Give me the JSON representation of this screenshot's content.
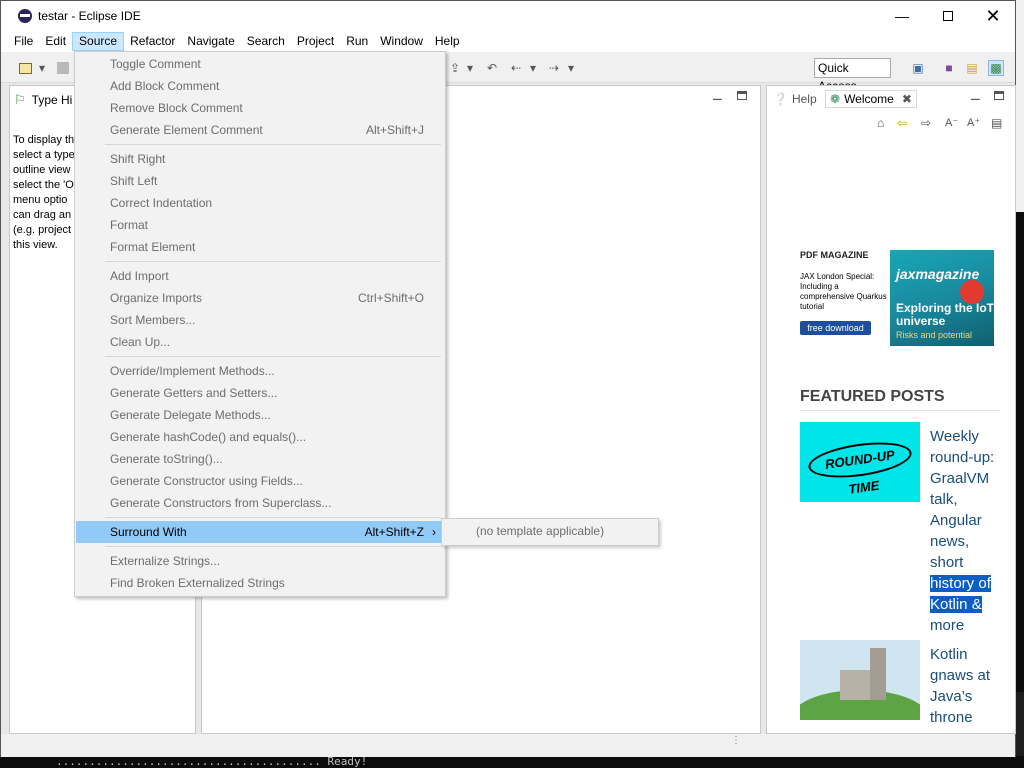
{
  "window": {
    "title": "testar - Eclipse IDE"
  },
  "menubar": {
    "items": [
      "File",
      "Edit",
      "Source",
      "Refactor",
      "Navigate",
      "Search",
      "Project",
      "Run",
      "Window",
      "Help"
    ]
  },
  "toolbar": {
    "quick_access": "Quick Access"
  },
  "type_hierarchy": {
    "tab_label": "Type Hi",
    "lines": [
      "To display th",
      "select a type",
      "outline view",
      "select the 'O",
      "menu optio",
      "can drag an",
      "(e.g. project",
      "this view."
    ]
  },
  "help_view": {
    "tabs": {
      "help": "Help",
      "welcome": "Welcome"
    },
    "ad": {
      "label": "PDF MAGAZINE",
      "text": "JAX London Special: Including a comprehensive Quarkus tutorial",
      "button": "free download",
      "cover_title": "jaxmagazine",
      "cover_subtitle": "Exploring the IoT universe",
      "cover_risk": "Risks and potential"
    },
    "featured_heading": "FEATURED POSTS",
    "post1": {
      "image_text": "ROUND-UP TIME",
      "title_plain": "Weekly round-up: GraalVM talk, Angular news, short",
      "title_highlight": "history of Kotlin &",
      "title_end": "more"
    },
    "post2": {
      "title": "Kotlin gnaws at Java’s throne"
    }
  },
  "source_menu": {
    "items": [
      {
        "label": "Toggle Comment",
        "shortcut": ""
      },
      {
        "label": "Add Block Comment",
        "shortcut": ""
      },
      {
        "label": "Remove Block Comment",
        "shortcut": ""
      },
      {
        "label": "Generate Element Comment",
        "shortcut": "Alt+Shift+J"
      },
      {
        "label": "Shift Right",
        "shortcut": ""
      },
      {
        "label": "Shift Left",
        "shortcut": ""
      },
      {
        "label": "Correct Indentation",
        "shortcut": ""
      },
      {
        "label": "Format",
        "shortcut": ""
      },
      {
        "label": "Format Element",
        "shortcut": ""
      },
      {
        "label": "Add Import",
        "shortcut": ""
      },
      {
        "label": "Organize Imports",
        "shortcut": "Ctrl+Shift+O"
      },
      {
        "label": "Sort Members...",
        "shortcut": ""
      },
      {
        "label": "Clean Up...",
        "shortcut": ""
      },
      {
        "label": "Override/Implement Methods...",
        "shortcut": ""
      },
      {
        "label": "Generate Getters and Setters...",
        "shortcut": ""
      },
      {
        "label": "Generate Delegate Methods...",
        "shortcut": ""
      },
      {
        "label": "Generate hashCode() and equals()...",
        "shortcut": ""
      },
      {
        "label": "Generate toString()...",
        "shortcut": ""
      },
      {
        "label": "Generate Constructor using Fields...",
        "shortcut": ""
      },
      {
        "label": "Generate Constructors from Superclass...",
        "shortcut": ""
      },
      {
        "label": "Surround With",
        "shortcut": "Alt+Shift+Z"
      },
      {
        "label": "Externalize Strings...",
        "shortcut": ""
      },
      {
        "label": "Find Broken Externalized Strings",
        "shortcut": ""
      }
    ],
    "submenu_item": "(no template applicable)"
  },
  "background_terminal": {
    "bottom_line": "........................................ Ready!"
  }
}
